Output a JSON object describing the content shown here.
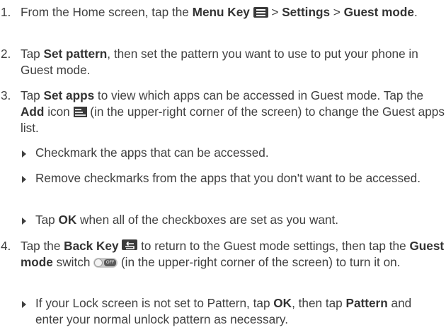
{
  "steps": [
    {
      "num": "1.",
      "t1": "From the Home screen, tap the ",
      "b1": "Menu Key",
      "icon1": "menu-key-icon",
      "t2": " > ",
      "b2": "Settings",
      "t3": " > ",
      "b3": "Guest mode",
      "t4": "."
    },
    {
      "num": "2.",
      "t1": "Tap ",
      "b1": "Set pattern",
      "t2": ", then set the pattern you want to use to put your phone in Guest mode."
    },
    {
      "num": "3.",
      "t1": "Tap ",
      "b1": "Set apps",
      "t2": " to view which apps can be accessed in Guest mode. Tap the ",
      "b2": "Add",
      "t3": " icon ",
      "icon1": "add-icon",
      "t4": " (in the upper-right corner of the screen) to change the Guest apps list."
    },
    {
      "num": "4.",
      "t1": "Tap the ",
      "b1": "Back Key",
      "icon1": "back-key-icon",
      "t2": " to return to the Guest mode settings, then tap the ",
      "b2": "Guest mode",
      "t3": " switch ",
      "icon2": "toggle-switch-icon",
      "t4": " (in the upper-right corner of the screen) to turn it on."
    }
  ],
  "step3_bullets": [
    {
      "t1": "Checkmark the apps that can be accessed."
    },
    {
      "t1": "Remove checkmarks from the apps that you don't want to be accessed."
    },
    {
      "t1": "Tap ",
      "b1": "OK",
      "t2": " when all of the checkboxes are set as you want."
    }
  ],
  "step4_bullets": [
    {
      "t1": "If your Lock screen is not set to Pattern, tap ",
      "b1": "OK",
      "t2": ", then tap ",
      "b2": "Pattern",
      "t3": " and enter your normal unlock pattern as necessary."
    }
  ],
  "icons": {
    "toggle_text": "OFF"
  }
}
